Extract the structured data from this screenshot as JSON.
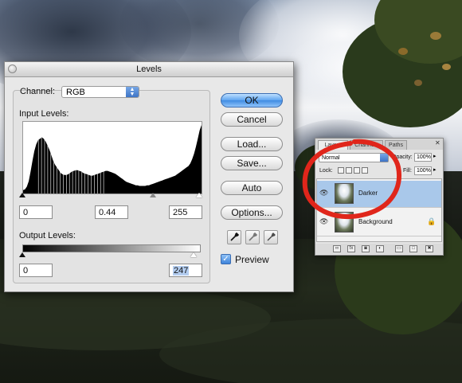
{
  "levels_dialog": {
    "title": "Levels",
    "channel_label": "Channel:",
    "channel_value": "RGB",
    "input_levels_label": "Input Levels:",
    "input_black": "0",
    "input_gamma": "0.44",
    "input_white": "255",
    "output_levels_label": "Output Levels:",
    "output_black": "0",
    "output_white": "247",
    "buttons": {
      "ok": "OK",
      "cancel": "Cancel",
      "load": "Load...",
      "save": "Save...",
      "auto": "Auto",
      "options": "Options..."
    },
    "preview_label": "Preview",
    "preview_checked": true,
    "histogram": [
      5,
      6,
      10,
      18,
      32,
      48,
      62,
      72,
      78,
      80,
      82,
      80,
      76,
      70,
      64,
      56,
      48,
      42,
      38,
      34,
      30,
      28,
      27,
      27,
      28,
      30,
      32,
      33,
      34,
      34,
      33,
      32,
      30,
      29,
      28,
      27,
      26,
      26,
      27,
      28,
      29,
      30,
      31,
      32,
      33,
      33,
      32,
      31,
      30,
      29,
      27,
      25,
      23,
      21,
      19,
      17,
      16,
      15,
      14,
      13,
      12,
      12,
      11,
      11,
      11,
      11,
      12,
      12,
      13,
      14,
      15,
      16,
      17,
      18,
      19,
      20,
      21,
      22,
      23,
      24,
      25,
      26,
      28,
      30,
      32,
      34,
      36,
      38,
      40,
      44,
      50,
      58,
      68,
      80,
      92,
      100
    ]
  },
  "layers_palette": {
    "tabs": [
      "Layers",
      "Channels",
      "Paths"
    ],
    "blend_mode": "Normal",
    "opacity_label": "Opacity:",
    "opacity_value": "100%",
    "lock_label": "Lock:",
    "fill_label": "Fill:",
    "fill_value": "100%",
    "layers": [
      {
        "name": "Darker",
        "selected": true
      },
      {
        "name": "Background",
        "selected": false
      }
    ],
    "bottom_icons": [
      "link-icon",
      "fx-icon",
      "mask-icon",
      "adjustment-icon",
      "group-icon",
      "new-layer-icon",
      "trash-icon"
    ]
  },
  "colors": {
    "ok_button": "#5ea4ef",
    "selected_layer": "#a9c8ea",
    "annotation_circle": "#e0261b"
  }
}
